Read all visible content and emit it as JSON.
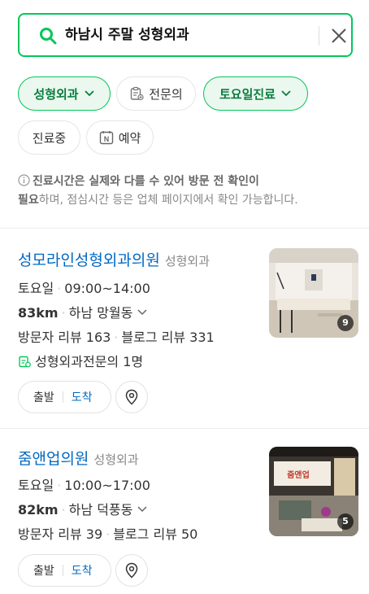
{
  "search": {
    "query": "하남시 주말 성형외과"
  },
  "filters": {
    "specialty": "성형외과",
    "specialist": "전문의",
    "day": "토요일진료",
    "open_now": "진료중",
    "booking": "예약"
  },
  "notice": {
    "bold1": "진료시간은 실제와 다를 수 있어 방문 전 확인이",
    "bold2": "필요",
    "rest": "하며, 점심시간 등은 업체 페이지에서 확인 가능합니다."
  },
  "results": [
    {
      "name": "성모라인성형외과의원",
      "category": "성형외과",
      "day": "토요일",
      "hours": "09:00~14:00",
      "distance": "83km",
      "area": "하남 망월동",
      "visitor_reviews": "방문자 리뷰 163",
      "blog_reviews": "블로그 리뷰 331",
      "specialist": "성형외과전문의 1명",
      "photo_count": "9",
      "depart": "출발",
      "arrive": "도착"
    },
    {
      "name": "줌앤업의원",
      "category": "성형외과",
      "day": "토요일",
      "hours": "10:00~17:00",
      "distance": "82km",
      "area": "하남 덕풍동",
      "visitor_reviews": "방문자 리뷰 39",
      "blog_reviews": "블로그 리뷰 50",
      "photo_count": "5",
      "sign_text": "줌앤업",
      "depart": "출발",
      "arrive": "도착"
    }
  ],
  "colors": {
    "accent": "#03c75a",
    "link": "#0068c3"
  }
}
